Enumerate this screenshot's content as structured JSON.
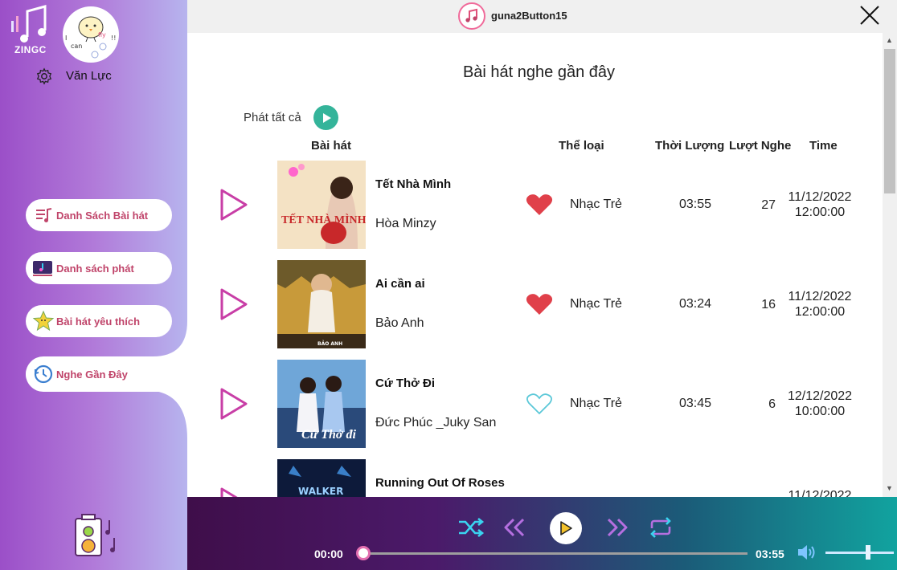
{
  "app": {
    "logo_text": "ZINGC",
    "window_title": "guna2Button15"
  },
  "user": {
    "name": "Văn Lực",
    "avatar_text": [
      "I",
      "can",
      "fly",
      "!!"
    ]
  },
  "sidebar": {
    "items": [
      {
        "label": "Danh Sách Bài hát",
        "icon": "music-list-icon"
      },
      {
        "label": "Danh sách phát",
        "icon": "playlist-icon"
      },
      {
        "label": "Bài hát yêu thích",
        "icon": "favorite-star-icon"
      },
      {
        "label": "Nghe Gần Đây",
        "icon": "history-clock-icon",
        "active": true
      }
    ]
  },
  "main": {
    "title": "Bài hát nghe gần đây",
    "play_all_label": "Phát tất cả",
    "columns": {
      "song": "Bài hát",
      "genre": "Thể loại",
      "duration": "Thời Lượng",
      "plays": "Lượt Nghe",
      "time": "Time"
    },
    "songs": [
      {
        "title": "Tết Nhà Mình",
        "artist": "Hòa Minzy",
        "liked": true,
        "genre": "Nhạc Trẻ",
        "duration": "03:55",
        "plays": "27",
        "date": "11/12/2022",
        "clock": "12:00:00",
        "cover_text": "TẾT NHÀ MÌNH"
      },
      {
        "title": "Ai cần ai",
        "artist": "Bảo Anh",
        "liked": true,
        "genre": "Nhạc Trẻ",
        "duration": "03:24",
        "plays": "16",
        "date": "11/12/2022",
        "clock": "12:00:00",
        "cover_text": "BẢO ANH"
      },
      {
        "title": "Cứ Thở Đi",
        "artist": "Đức Phúc _Juky San",
        "liked": false,
        "genre": "Nhạc Trẻ",
        "duration": "03:45",
        "plays": "6",
        "date": "12/12/2022",
        "clock": "10:00:00",
        "cover_text": "Cứ Thở đi"
      },
      {
        "title": "Running Out Of Roses",
        "artist": "",
        "liked": false,
        "genre": "",
        "duration": "",
        "plays": "",
        "date": "11/12/2022",
        "clock": "",
        "cover_text": "WALKER"
      }
    ]
  },
  "player": {
    "current_time": "00:00",
    "total_time": "03:55",
    "progress": 0,
    "volume": 0.62
  },
  "colors": {
    "accent_pink": "#c0446a",
    "heart_red": "#e0404a",
    "heart_outline": "#5bc8d8",
    "play_all": "#34b49a"
  }
}
